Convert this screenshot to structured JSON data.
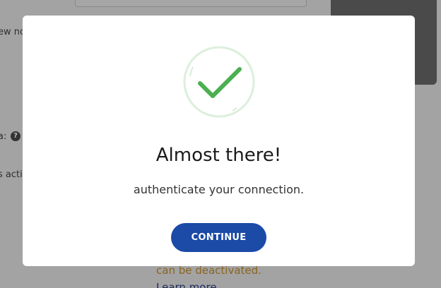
{
  "background": {
    "text_new": "ew no",
    "text_label": "a:",
    "help_icon": "?",
    "text_activ": "s activ",
    "warning": "can be deactivated.",
    "learn_more": "Learn more"
  },
  "modal": {
    "icon": "check-circle-icon",
    "title": "Almost there!",
    "subtitle": "authenticate your connection.",
    "continue_label": "CONTINUE"
  },
  "colors": {
    "accent": "#1b4aa7",
    "check": "#4caf50",
    "ring": "#dcefdc"
  }
}
